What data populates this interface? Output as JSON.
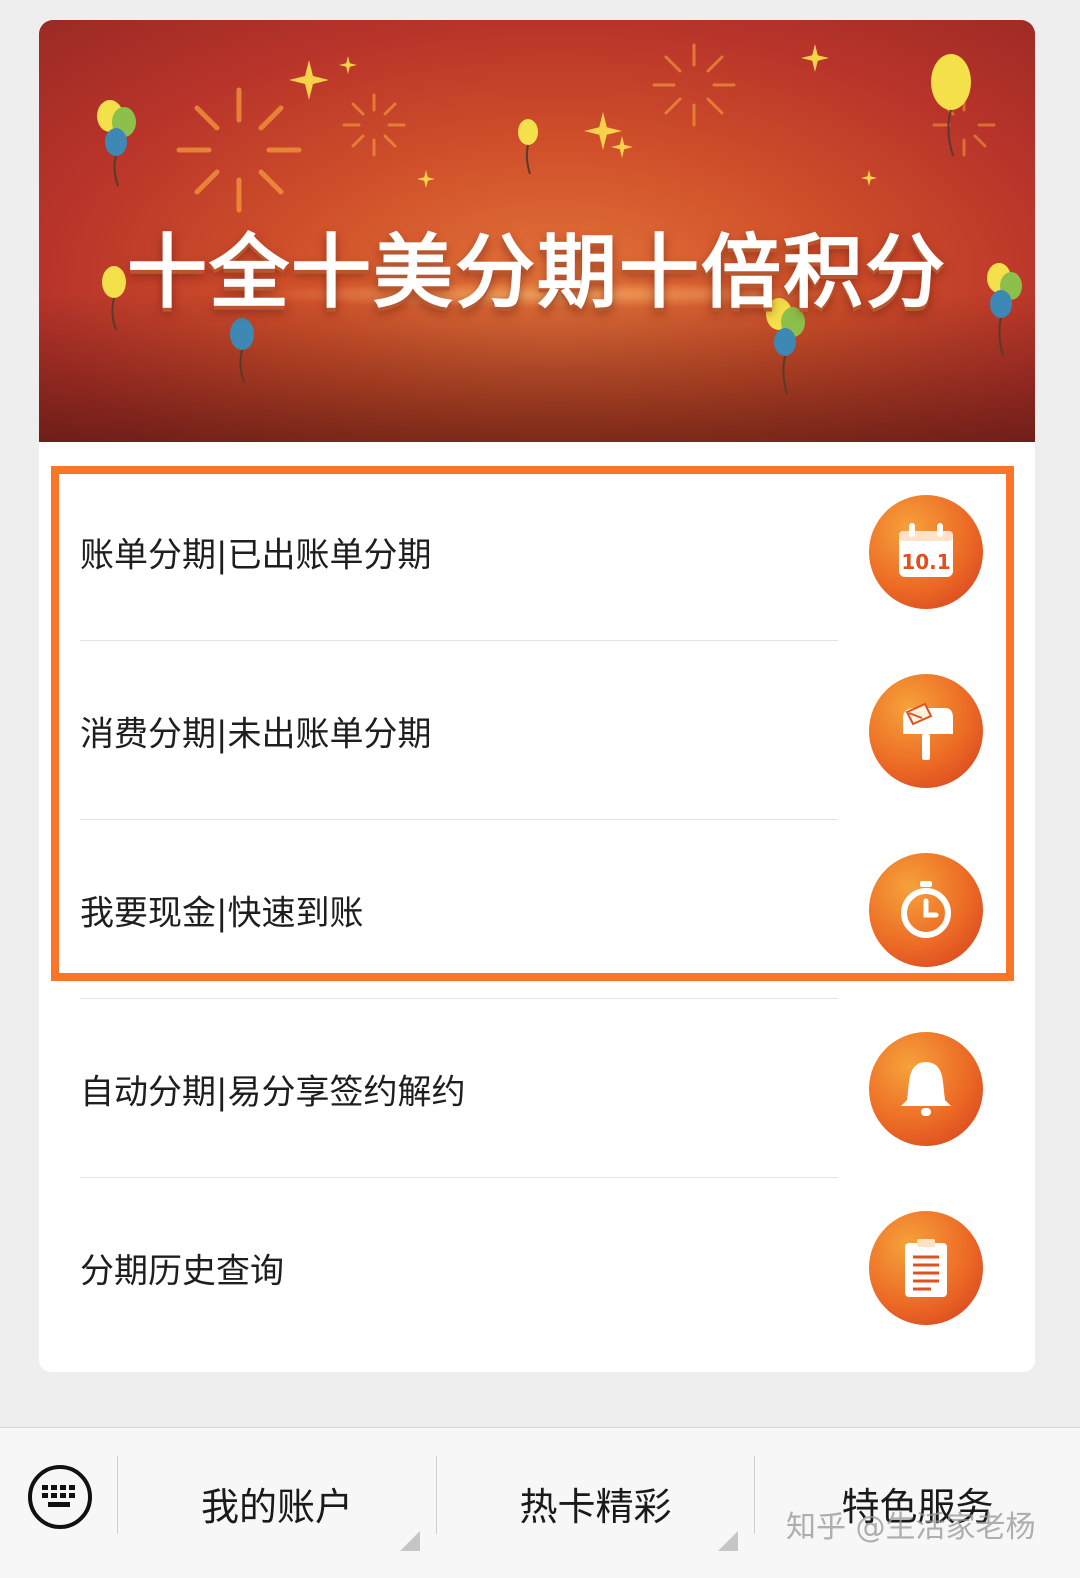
{
  "banner": {
    "title": "十全十美分期十倍积分"
  },
  "menu": {
    "items": [
      {
        "label": "账单分期|已出账单分期",
        "icon": "calendar-icon"
      },
      {
        "label": "消费分期|未出账单分期",
        "icon": "mailbox-icon"
      },
      {
        "label": "我要现金|快速到账",
        "icon": "stopwatch-icon"
      },
      {
        "label": "自动分期|易分享签约解约",
        "icon": "bell-icon"
      },
      {
        "label": "分期历史查询",
        "icon": "clipboard-icon"
      }
    ],
    "calendar_text": "10.1"
  },
  "tabbar": {
    "keyboard_icon": "keyboard-icon",
    "tabs": [
      {
        "label": "我的账户"
      },
      {
        "label": "热卡精彩"
      },
      {
        "label": "特色服务"
      }
    ]
  },
  "watermark": "知乎 @生活家老杨",
  "colors": {
    "accent": "#fb7528",
    "icon_orange": "#ec6a25",
    "banner_red": "#c0392b"
  }
}
